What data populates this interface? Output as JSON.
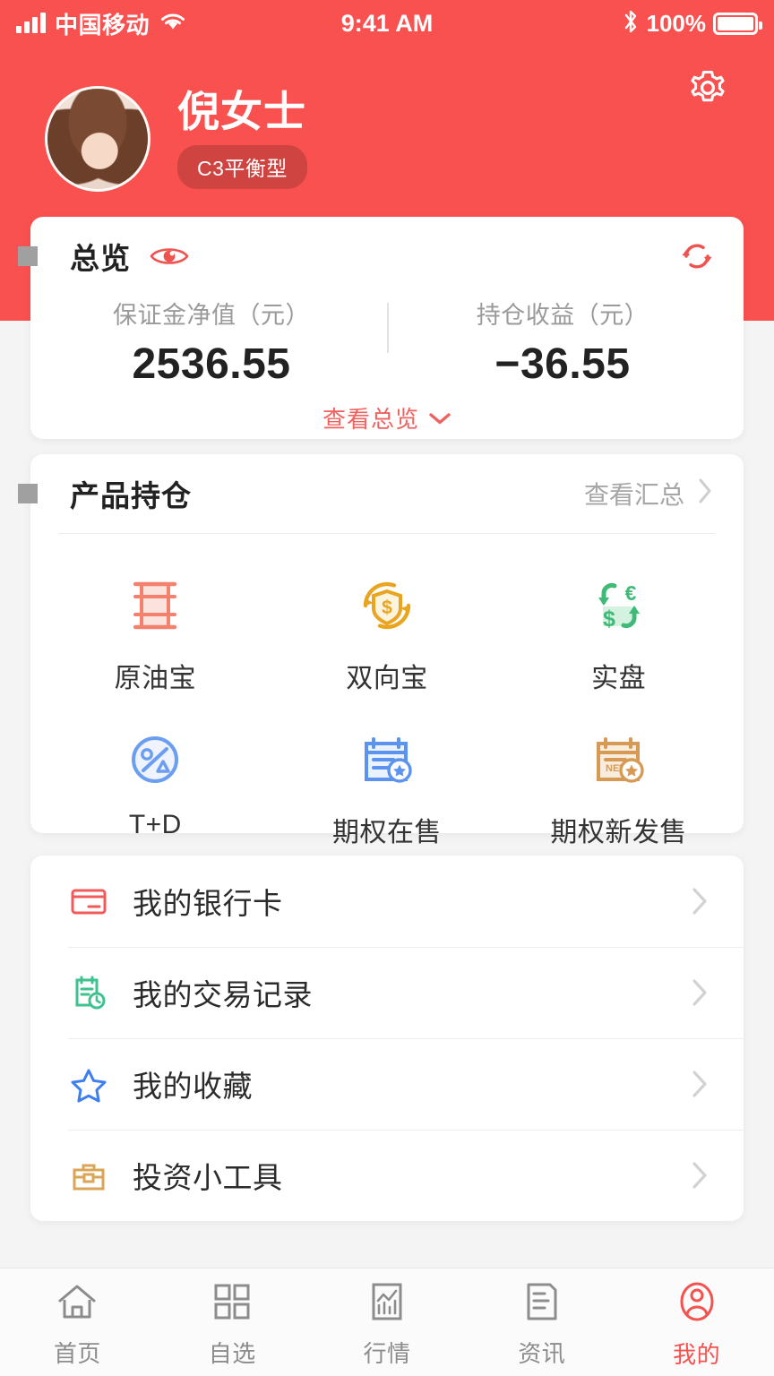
{
  "theme": {
    "brand_red": "#f9514f",
    "accent_red": "#f0625f",
    "muted": "#9a9a9a"
  },
  "statusbar": {
    "carrier": "中国移动",
    "time": "9:41 AM",
    "battery_percent": "100%",
    "signal_icon": "signal-bars-icon",
    "wifi_icon": "wifi-icon",
    "bluetooth_icon": "bluetooth-icon",
    "battery_icon": "battery-full-icon"
  },
  "header": {
    "avatar_icon": "user-avatar-photo",
    "name": "倪女士",
    "risk_badge": "C3平衡型",
    "settings_icon": "gear-icon"
  },
  "overview": {
    "title": "总览",
    "eye_icon": "eye-icon",
    "refresh_icon": "refresh-icon",
    "stats": [
      {
        "label": "保证金净值（元）",
        "value": "2536.55"
      },
      {
        "label": "持仓收益（元）",
        "value": "−36.55"
      }
    ],
    "more_label": "查看总览",
    "more_icon": "chevron-down-icon"
  },
  "holdings": {
    "title": "产品持仓",
    "more_label": "查看汇总",
    "more_icon": "chevron-right-icon",
    "items": [
      {
        "label": "原油宝",
        "icon": "oil-barrel-icon",
        "color": "#f4816e"
      },
      {
        "label": "双向宝",
        "icon": "shield-dollar-refresh-icon",
        "color": "#e9a51f"
      },
      {
        "label": "实盘",
        "icon": "currency-exchange-icon",
        "color": "#5cc18c"
      },
      {
        "label": "T+D",
        "icon": "percent-circle-icon",
        "color": "#6b9ef0"
      },
      {
        "label": "期权在售",
        "icon": "calendar-star-icon",
        "color": "#5b93ef"
      },
      {
        "label": "期权新发售",
        "icon": "calendar-new-star-icon",
        "color": "#d79a55"
      }
    ]
  },
  "menu": {
    "items": [
      {
        "label": "我的银行卡",
        "icon": "bank-card-icon",
        "color": "#f05a59"
      },
      {
        "label": "我的交易记录",
        "icon": "clipboard-clock-icon",
        "color": "#3ec28f"
      },
      {
        "label": "我的收藏",
        "icon": "star-outline-icon",
        "color": "#3d7ef0"
      },
      {
        "label": "投资小工具",
        "icon": "toolbox-icon",
        "color": "#dba557"
      }
    ],
    "chevron_icon": "chevron-right-icon"
  },
  "tabbar": {
    "tabs": [
      {
        "label": "首页",
        "icon": "home-icon",
        "active": false
      },
      {
        "label": "自选",
        "icon": "grid-icon",
        "active": false
      },
      {
        "label": "行情",
        "icon": "chart-icon",
        "active": false
      },
      {
        "label": "资讯",
        "icon": "news-icon",
        "active": false
      },
      {
        "label": "我的",
        "icon": "user-circle-icon",
        "active": true
      }
    ]
  }
}
